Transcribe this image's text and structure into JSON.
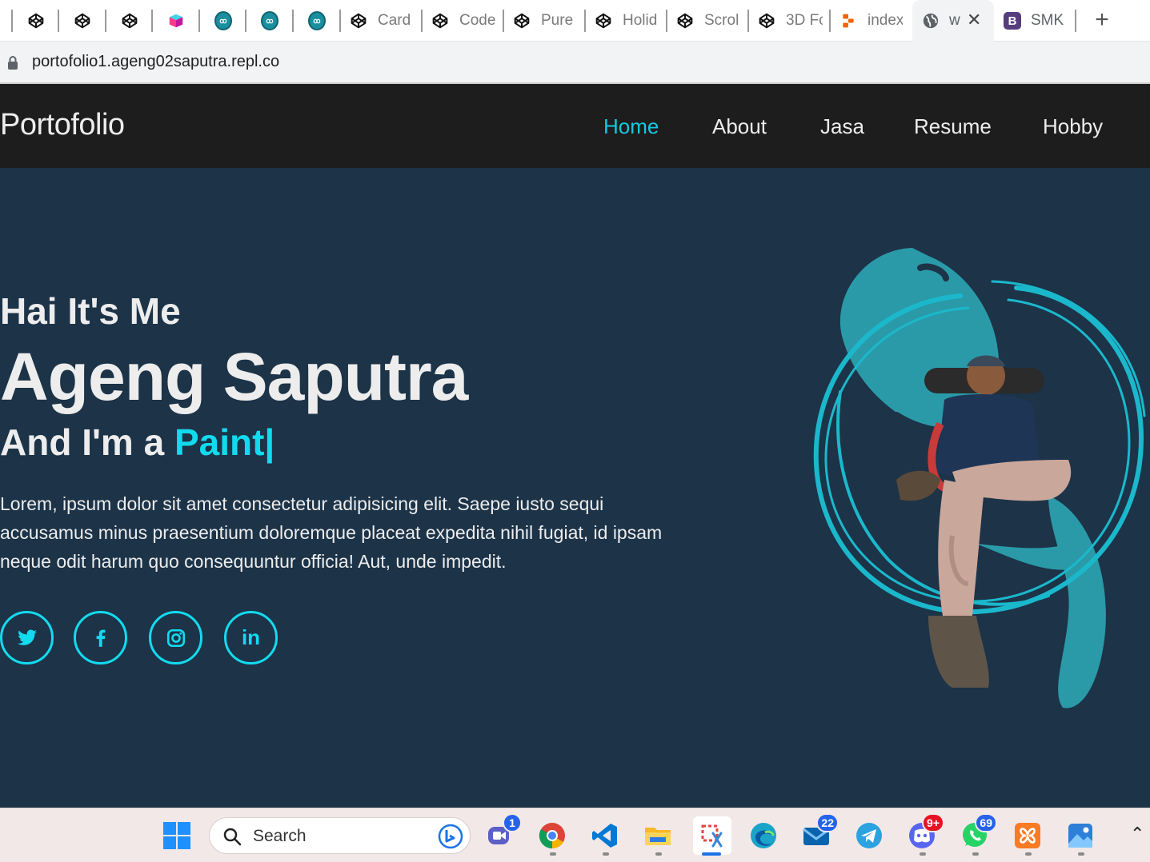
{
  "browser": {
    "tabs": [
      {
        "label": "",
        "icon": "codepen-icon"
      },
      {
        "label": "",
        "icon": "codepen-icon"
      },
      {
        "label": "",
        "icon": "codepen-icon"
      },
      {
        "label": "",
        "icon": "box-logo-icon"
      },
      {
        "label": "",
        "icon": "circle-logo-icon"
      },
      {
        "label": "",
        "icon": "circle-logo-icon"
      },
      {
        "label": "",
        "icon": "circle-logo-icon"
      },
      {
        "label": "Card",
        "icon": "codepen-icon"
      },
      {
        "label": "Code",
        "icon": "codepen-icon"
      },
      {
        "label": "Pure",
        "icon": "codepen-icon"
      },
      {
        "label": "Holid",
        "icon": "codepen-icon"
      },
      {
        "label": "Scroll",
        "icon": "codepen-icon"
      },
      {
        "label": "3D Fc",
        "icon": "codepen-icon"
      },
      {
        "label": "index",
        "icon": "replit-icon"
      },
      {
        "label": "w",
        "icon": "globe-icon",
        "active": true
      },
      {
        "label": "SMK",
        "icon": "bootstrap-icon"
      }
    ],
    "new_tab_glyph": "+",
    "close_glyph": "✕",
    "url": "portofolio1.ageng02saputra.repl.co"
  },
  "site": {
    "brand": "Portofolio",
    "nav": [
      "Home",
      "About",
      "Jasa",
      "Resume",
      "Hobby"
    ],
    "active_nav": "Home",
    "hero": {
      "greeting": "Hai It's Me",
      "name": "Ageng Saputra",
      "role_prefix": "And I'm a ",
      "role_typed": "Paint|",
      "description": "Lorem, ipsum dolor sit amet consectetur adipisicing elit. Saepe iusto sequi accusamus minus praesentium doloremque placeat expedita nihil fugiat, id ipsam neque odit harum quo consequuntur officia! Aut, unde impedit.",
      "socials": [
        "twitter-icon",
        "facebook-icon",
        "instagram-icon",
        "linkedin-icon"
      ],
      "linkedin_text": "in"
    },
    "colors": {
      "accent": "#13dbef",
      "hero_bg": "#1c3348",
      "navbar_bg": "#1d1d1d",
      "text": "#ededed",
      "brush": "#2a9aa8"
    }
  },
  "taskbar": {
    "search_placeholder": "Search",
    "apps": [
      {
        "name": "teams",
        "badge": "1"
      },
      {
        "name": "chrome",
        "badge": ""
      },
      {
        "name": "vscode",
        "badge": ""
      },
      {
        "name": "file-explorer",
        "badge": ""
      },
      {
        "name": "snipping-tool",
        "badge": ""
      },
      {
        "name": "edge",
        "badge": ""
      },
      {
        "name": "mail",
        "badge": "22"
      },
      {
        "name": "telegram",
        "badge": ""
      },
      {
        "name": "discord",
        "badge": "9+"
      },
      {
        "name": "whatsapp",
        "badge": "69"
      },
      {
        "name": "xampp",
        "badge": ""
      },
      {
        "name": "photos",
        "badge": ""
      }
    ]
  }
}
